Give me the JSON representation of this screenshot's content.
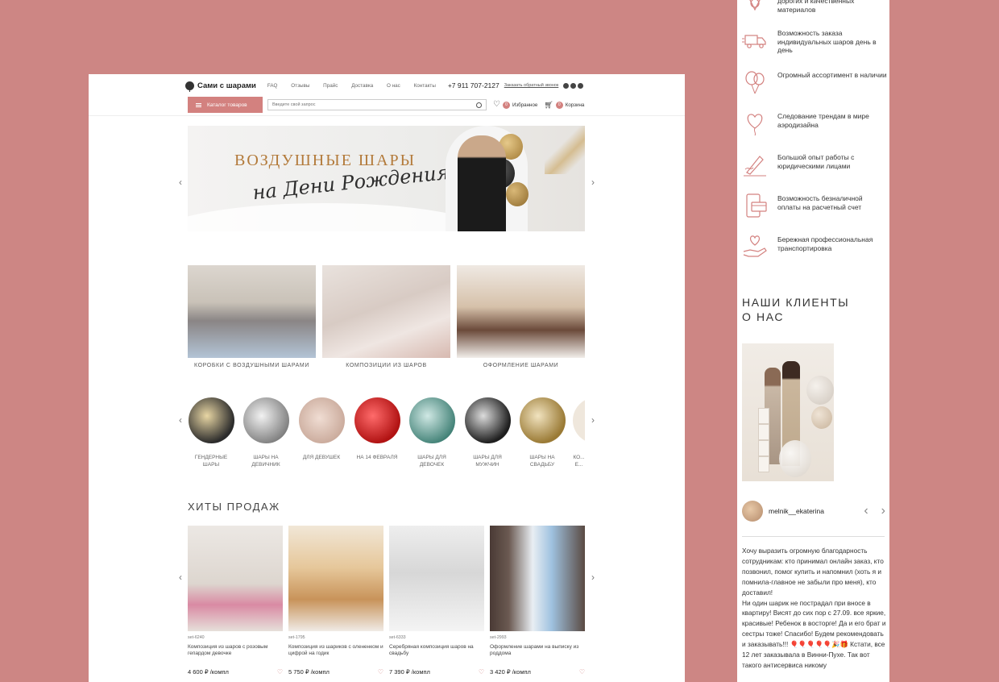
{
  "header": {
    "logo": "Сами с шарами",
    "nav": [
      "FAQ",
      "Отзывы",
      "Прайс",
      "Доставка",
      "О нас",
      "Контакты"
    ],
    "phone": "+7 911 707-2127",
    "callback": "Заказать обратный звонок",
    "catalog_button": "Каталог товаров",
    "search_placeholder": "Введите свой запрос",
    "favorites_label": "Избранное",
    "favorites_count": "0",
    "cart_label": "Корзина",
    "cart_count": "0"
  },
  "banner": {
    "title": "ВОЗДУШНЫЕ ШАРЫ",
    "subtitle": "на Дени Рождения!"
  },
  "categories": [
    {
      "label": "КОРОБКИ С ВОЗДУШНЫМИ ШАРАМИ"
    },
    {
      "label": "КОМПОЗИЦИИ ИЗ ШАРОВ"
    },
    {
      "label": "ОФОРМЛЕНИЕ ШАРАМИ"
    }
  ],
  "circles": [
    {
      "label": "ГЕНДЕРНЫЕ ШАРЫ"
    },
    {
      "label": "ШАРЫ НА ДЕВИЧНИК"
    },
    {
      "label": "ДЛЯ ДЕВУШЕК"
    },
    {
      "label": "НА 14 ФЕВРАЛЯ"
    },
    {
      "label": "ШАРЫ ДЛЯ ДЕВОЧЕК"
    },
    {
      "label": "ШАРЫ ДЛЯ МУЖЧИН"
    },
    {
      "label": "ШАРЫ НА СВАДЬБУ"
    },
    {
      "label": "КО... Е..."
    }
  ],
  "hits": {
    "title": "ХИТЫ ПРОДАЖ",
    "products": [
      {
        "sku": "set-6240",
        "name": "Композиция из шаров с розовым гепардом девочке",
        "price": "4 600 ₽ /компл"
      },
      {
        "sku": "set-1795",
        "name": "Композиция из шариков с олененком и цифрой на годик",
        "price": "5 750 ₽ /компл"
      },
      {
        "sku": "set-6333",
        "name": "Серебряная композиция шаров на свадьбу",
        "price": "7 390 ₽ /компл"
      },
      {
        "sku": "set-2993",
        "name": "Оформление шарами на выписку из роддома",
        "price": "3 420 ₽ /компл"
      }
    ]
  },
  "mobile": {
    "advantages": [
      {
        "icon": "quality-icon",
        "text": "дорогих и качественных материалов"
      },
      {
        "icon": "truck-icon",
        "text": "Возможность заказа индивидуальных шаров день в день"
      },
      {
        "icon": "balloons-icon",
        "text": "Огромный ассортимент в наличии"
      },
      {
        "icon": "heart-balloon-icon",
        "text": "Следование трендам в мире аэродизайна"
      },
      {
        "icon": "pen-icon",
        "text": "Большой опыт работы с юридическими лицами"
      },
      {
        "icon": "payment-icon",
        "text": "Возможность безналичной оплаты на расчетный счет"
      },
      {
        "icon": "care-icon",
        "text": "Бережная профессиональная транспортировка"
      }
    ],
    "clients_title_line1": "НАШИ КЛИЕНТЫ",
    "clients_title_line2": "О НАС",
    "username": "melnik__ekaterina",
    "review": [
      "Хочу выразить огромную благодарность сотрудникам: кто принимал онлайн заказ, кто позвонил, помог купить и напомнил (хоть я и помнила-главное не забыли про меня), кто доставил!",
      "Ни один шарик не пострадал при вносе в квартиру! Висят до сих пор с 27.09. все яркие, красивые! Ребенок в восторге! Да и его брат и сестры тоже! Спасибо! Будем рекомендовать и заказывать!!! 🎈🎈🎈🎈🎈🎉🎁 Кстати, все 12 лет заказывала в Винни-Пухе. Так вот такого антисервиса никому"
    ]
  },
  "colors": {
    "background": "#cd8684",
    "accent": "#d3817f"
  }
}
